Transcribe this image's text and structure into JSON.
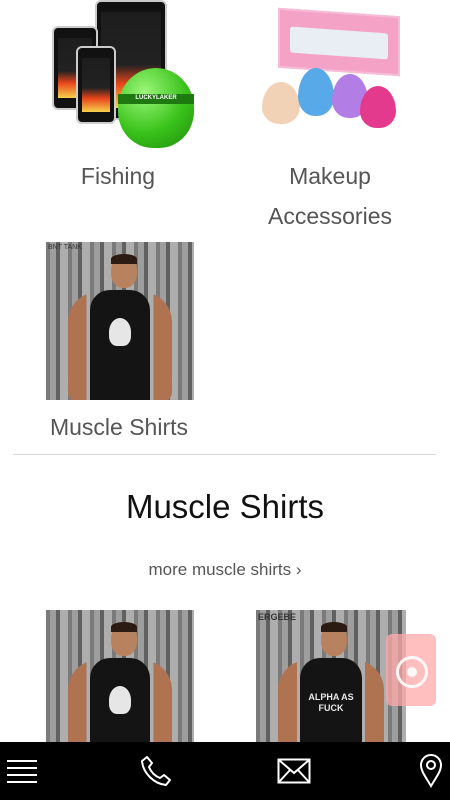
{
  "categories": [
    {
      "label": "Fishing",
      "image": "fish-finder-product"
    },
    {
      "label": "Makeup Accessories",
      "image": "makeup-sponges-product"
    },
    {
      "label": "Muscle Shirts",
      "image": "muscle-shirt-product"
    }
  ],
  "section": {
    "title": "Muscle Shirts",
    "more_link": "more muscle shirts ›"
  },
  "products": [
    {
      "image": "punisher-tank-top"
    },
    {
      "image": "alpha-tank-top",
      "shirt_text": "ALPHA AS FUCK"
    }
  ],
  "bottom_bar": {
    "items": [
      "menu-icon",
      "phone-icon",
      "mail-icon",
      "location-pin-icon"
    ],
    "background": "#000000",
    "icon_color": "#ffffff"
  },
  "colors": {
    "fab": "#ffaaaa",
    "divider": "#d7d7d7"
  }
}
